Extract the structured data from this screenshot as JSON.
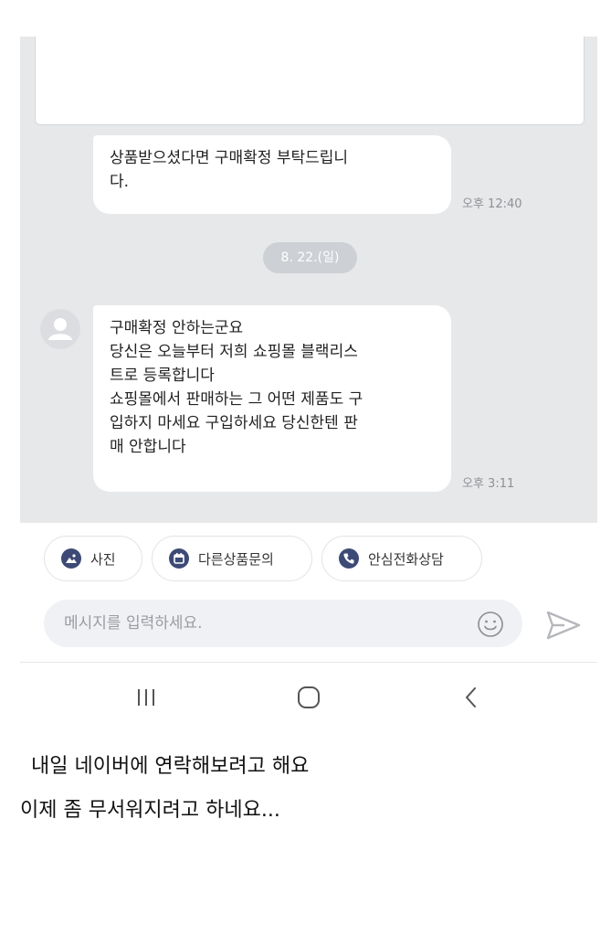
{
  "chat": {
    "messages": [
      {
        "lines": [
          "상품받으셨다면 구매확정 부탁드립니",
          "다."
        ],
        "time": "오후 12:40"
      },
      {
        "lines": [
          "구매확정 안하는군요",
          "당신은 오늘부터 저희 쇼핑몰 블랙리스",
          "트로 등록합니다",
          "쇼핑몰에서 판매하는 그 어떤 제품도 구",
          "입하지 마세요 구입하세요 당신한텐 판",
          "매 안합니다"
        ],
        "time": "오후 3:11"
      }
    ],
    "date_divider": "8. 22.(일)"
  },
  "quick_actions": [
    {
      "label": "사진",
      "icon": "image-icon"
    },
    {
      "label": "다른상품문의",
      "icon": "calendar-icon"
    },
    {
      "label": "안심전화상담",
      "icon": "phone-icon"
    }
  ],
  "composer": {
    "placeholder": "메시지를 입력하세요.",
    "emoji_icon": "smiley-icon",
    "send_icon": "send-icon"
  },
  "nav": {
    "recent_icon": "recent-apps-icon",
    "home_icon": "home-icon",
    "back_icon": "back-icon"
  },
  "caption": {
    "line1": "내일 네이버에 연락해보려고 해요",
    "line2": "이제 좀 무서워지려고 하네요..."
  },
  "colors": {
    "chat_bg": "#e7e8ea",
    "bubble_bg": "#ffffff",
    "icon_accent": "#3d4a75",
    "date_pill": "#cdd0d4"
  }
}
